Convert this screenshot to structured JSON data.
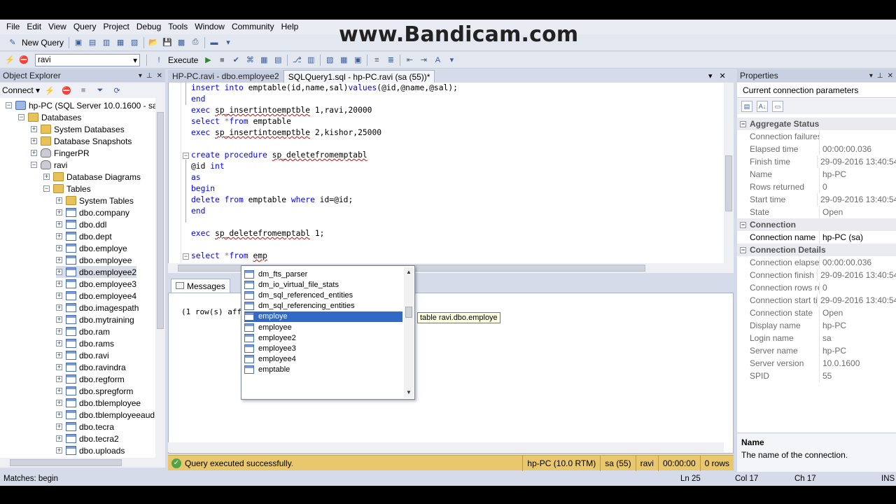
{
  "watermark": "www.Bandicam.com",
  "menu": [
    "File",
    "Edit",
    "View",
    "Query",
    "Project",
    "Debug",
    "Tools",
    "Window",
    "Community",
    "Help"
  ],
  "toolbar1": {
    "new_query": "New Query"
  },
  "toolbar2": {
    "database": "ravi",
    "execute": "Execute"
  },
  "object_explorer": {
    "title": "Object Explorer",
    "connect": "Connect",
    "tree": [
      {
        "label": "hp-PC (SQL Server 10.0.1600 - sa)",
        "icon": "server",
        "exp": "−"
      },
      {
        "label": "Databases",
        "icon": "folder",
        "exp": "−"
      },
      {
        "label": "System Databases",
        "icon": "folder",
        "exp": "+"
      },
      {
        "label": "Database Snapshots",
        "icon": "folder",
        "exp": "+"
      },
      {
        "label": "FingerPR",
        "icon": "db",
        "exp": "+"
      },
      {
        "label": "ravi",
        "icon": "db",
        "exp": "−"
      },
      {
        "label": "Database Diagrams",
        "icon": "folder",
        "exp": "+"
      },
      {
        "label": "Tables",
        "icon": "folder",
        "exp": "−"
      },
      {
        "label": "System Tables",
        "icon": "folder",
        "exp": "+"
      },
      {
        "label": "dbo.company",
        "icon": "table",
        "exp": "+"
      },
      {
        "label": "dbo.ddl",
        "icon": "table",
        "exp": "+"
      },
      {
        "label": "dbo.dept",
        "icon": "table",
        "exp": "+"
      },
      {
        "label": "dbo.employe",
        "icon": "table",
        "exp": "+"
      },
      {
        "label": "dbo.employee",
        "icon": "table",
        "exp": "+"
      },
      {
        "label": "dbo.employee2",
        "icon": "table",
        "exp": "+",
        "selected": true
      },
      {
        "label": "dbo.employee3",
        "icon": "table",
        "exp": "+"
      },
      {
        "label": "dbo.employee4",
        "icon": "table",
        "exp": "+"
      },
      {
        "label": "dbo.imagespath",
        "icon": "table",
        "exp": "+"
      },
      {
        "label": "dbo.mytraining",
        "icon": "table",
        "exp": "+"
      },
      {
        "label": "dbo.ram",
        "icon": "table",
        "exp": "+"
      },
      {
        "label": "dbo.rams",
        "icon": "table",
        "exp": "+"
      },
      {
        "label": "dbo.ravi",
        "icon": "table",
        "exp": "+"
      },
      {
        "label": "dbo.ravindra",
        "icon": "table",
        "exp": "+"
      },
      {
        "label": "dbo.regform",
        "icon": "table",
        "exp": "+"
      },
      {
        "label": "dbo.spregform",
        "icon": "table",
        "exp": "+"
      },
      {
        "label": "dbo.tblemployee",
        "icon": "table",
        "exp": "+"
      },
      {
        "label": "dbo.tblemployeeaudi",
        "icon": "table",
        "exp": "+"
      },
      {
        "label": "dbo.tecra",
        "icon": "table",
        "exp": "+"
      },
      {
        "label": "dbo.tecra2",
        "icon": "table",
        "exp": "+"
      },
      {
        "label": "dbo.uploads",
        "icon": "table",
        "exp": "+"
      }
    ]
  },
  "doc_tabs": {
    "inactive": "HP-PC.ravi - dbo.employee2",
    "active": "SQLQuery1.sql - hp-PC.ravi (sa (55))*"
  },
  "editor": {
    "lines": [
      "insert into emptable(id,name,sal)values(@id,@name,@sal);",
      "end",
      "exec sp_insertintoemptble 1,ravi,20000",
      "select *from emptable",
      "exec sp_insertintoemptble 2,kishor,25000",
      "",
      "create procedure sp_deletefromemptabl",
      "@id int",
      "as",
      "begin",
      "delete from emptable where id=@id;",
      "end",
      "",
      "exec sp_deletefromemptabl 1;",
      "",
      "select *from emp"
    ]
  },
  "intellisense": {
    "items": [
      {
        "label": "dm_fts_parser",
        "selected": false
      },
      {
        "label": "dm_io_virtual_file_stats",
        "selected": false
      },
      {
        "label": "dm_sql_referenced_entities",
        "selected": false
      },
      {
        "label": "dm_sql_referencing_entities",
        "selected": false
      },
      {
        "label": "employe",
        "selected": true
      },
      {
        "label": "employee",
        "selected": false
      },
      {
        "label": "employee2",
        "selected": false
      },
      {
        "label": "employee3",
        "selected": false
      },
      {
        "label": "employee4",
        "selected": false
      },
      {
        "label": "emptable",
        "selected": false
      }
    ],
    "tooltip": "table ravi.dbo.employe"
  },
  "results": {
    "tab": "Messages",
    "message": "(1 row(s) aff"
  },
  "query_status": {
    "message": "Query executed successfully.",
    "server": "hp-PC (10.0 RTM)",
    "user": "sa (55)",
    "database": "ravi",
    "time": "00:00:00",
    "rows": "0 rows"
  },
  "app_status": {
    "left": "Matches: begin",
    "ln": "Ln 25",
    "col": "Col 17",
    "ch": "Ch 17",
    "mode": "INS"
  },
  "properties": {
    "title": "Properties",
    "object": "Current connection parameters",
    "categories": [
      {
        "name": "Aggregate Status",
        "rows": [
          {
            "name": "Connection failures",
            "value": "",
            "enabled": false
          },
          {
            "name": "Elapsed time",
            "value": "00:00:00.036",
            "enabled": false
          },
          {
            "name": "Finish time",
            "value": "29-09-2016 13:40:54",
            "enabled": false
          },
          {
            "name": "Name",
            "value": "hp-PC",
            "enabled": false
          },
          {
            "name": "Rows returned",
            "value": "0",
            "enabled": false
          },
          {
            "name": "Start time",
            "value": "29-09-2016 13:40:54",
            "enabled": false
          },
          {
            "name": "State",
            "value": "Open",
            "enabled": false
          }
        ]
      },
      {
        "name": "Connection",
        "rows": [
          {
            "name": "Connection name",
            "value": "hp-PC (sa)",
            "enabled": true
          }
        ]
      },
      {
        "name": "Connection Details",
        "rows": [
          {
            "name": "Connection elapsed",
            "value": "00:00:00.036",
            "enabled": false
          },
          {
            "name": "Connection finish t",
            "value": "29-09-2016 13:40:54",
            "enabled": false
          },
          {
            "name": "Connection rows re",
            "value": "0",
            "enabled": false
          },
          {
            "name": "Connection start tir",
            "value": "29-09-2016 13:40:54",
            "enabled": false
          },
          {
            "name": "Connection state",
            "value": "Open",
            "enabled": false
          },
          {
            "name": "Display name",
            "value": "hp-PC",
            "enabled": false
          },
          {
            "name": "Login name",
            "value": "sa",
            "enabled": false
          },
          {
            "name": "Server name",
            "value": "hp-PC",
            "enabled": false
          },
          {
            "name": "Server version",
            "value": "10.0.1600",
            "enabled": false
          },
          {
            "name": "SPID",
            "value": "55",
            "enabled": false
          }
        ]
      }
    ],
    "desc_title": "Name",
    "desc_text": "The name of the connection."
  }
}
